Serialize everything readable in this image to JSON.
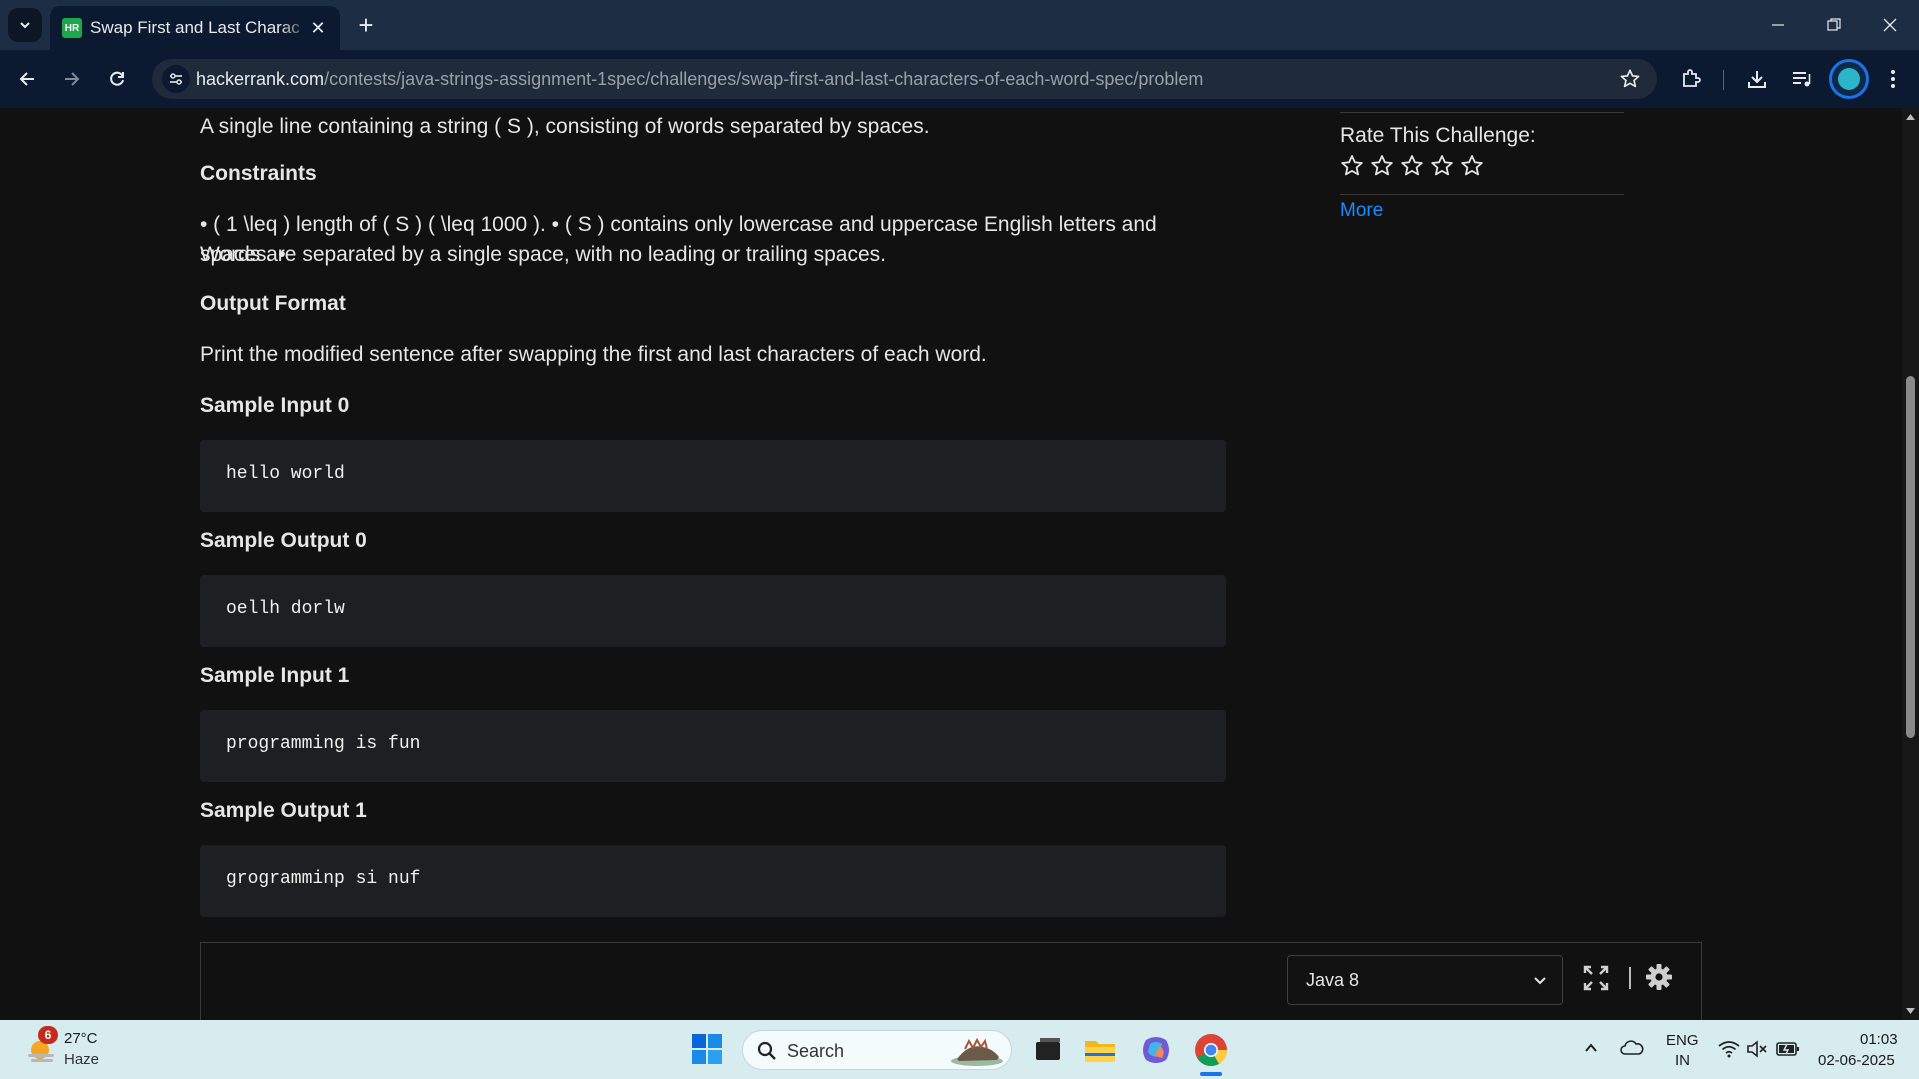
{
  "browser": {
    "tab_title": "Swap First and Last Characters of Each Word",
    "favicon_text": "HR",
    "url_host": "hackerrank.com",
    "url_path": "/contests/java-strings-assignment-1spec/challenges/swap-first-and-last-characters-of-each-word-spec/problem"
  },
  "problem": {
    "input_format_text": "A single line containing a string ( S ), consisting of words separated by spaces.",
    "constraints_heading": "Constraints",
    "constraints_line1": "• ( 1 \\leq ) length of ( S ) ( \\leq 1000 ). • ( S ) contains only lowercase and uppercase English letters and spaces. •",
    "constraints_line2": "Words are separated by a single space, with no leading or trailing spaces.",
    "output_format_heading": "Output Format",
    "output_format_text": "Print the modified sentence after swapping the first and last characters of each word.",
    "samples": [
      {
        "heading": "Sample Input 0",
        "code": "hello world"
      },
      {
        "heading": "Sample Output 0",
        "code": "oellh dorlw"
      },
      {
        "heading": "Sample Input 1",
        "code": "programming is fun"
      },
      {
        "heading": "Sample Output 1",
        "code": "grogramminp si nuf"
      }
    ]
  },
  "sidebar": {
    "rate_label": "Rate This Challenge:",
    "rating": 0,
    "max_rating": 5,
    "more_link": "More"
  },
  "editor": {
    "language": "Java 8"
  },
  "taskbar": {
    "weather_badge": "6",
    "weather_temp": "27°C",
    "weather_desc": "Haze",
    "search_placeholder": "Search",
    "lang_top": "ENG",
    "lang_bottom": "IN",
    "time": "01:03",
    "date": "02-06-2025"
  },
  "colors": {
    "link": "#1a8cff",
    "hackerrank_green": "#1ba94c",
    "chrome_accent": "#1a73e8"
  }
}
